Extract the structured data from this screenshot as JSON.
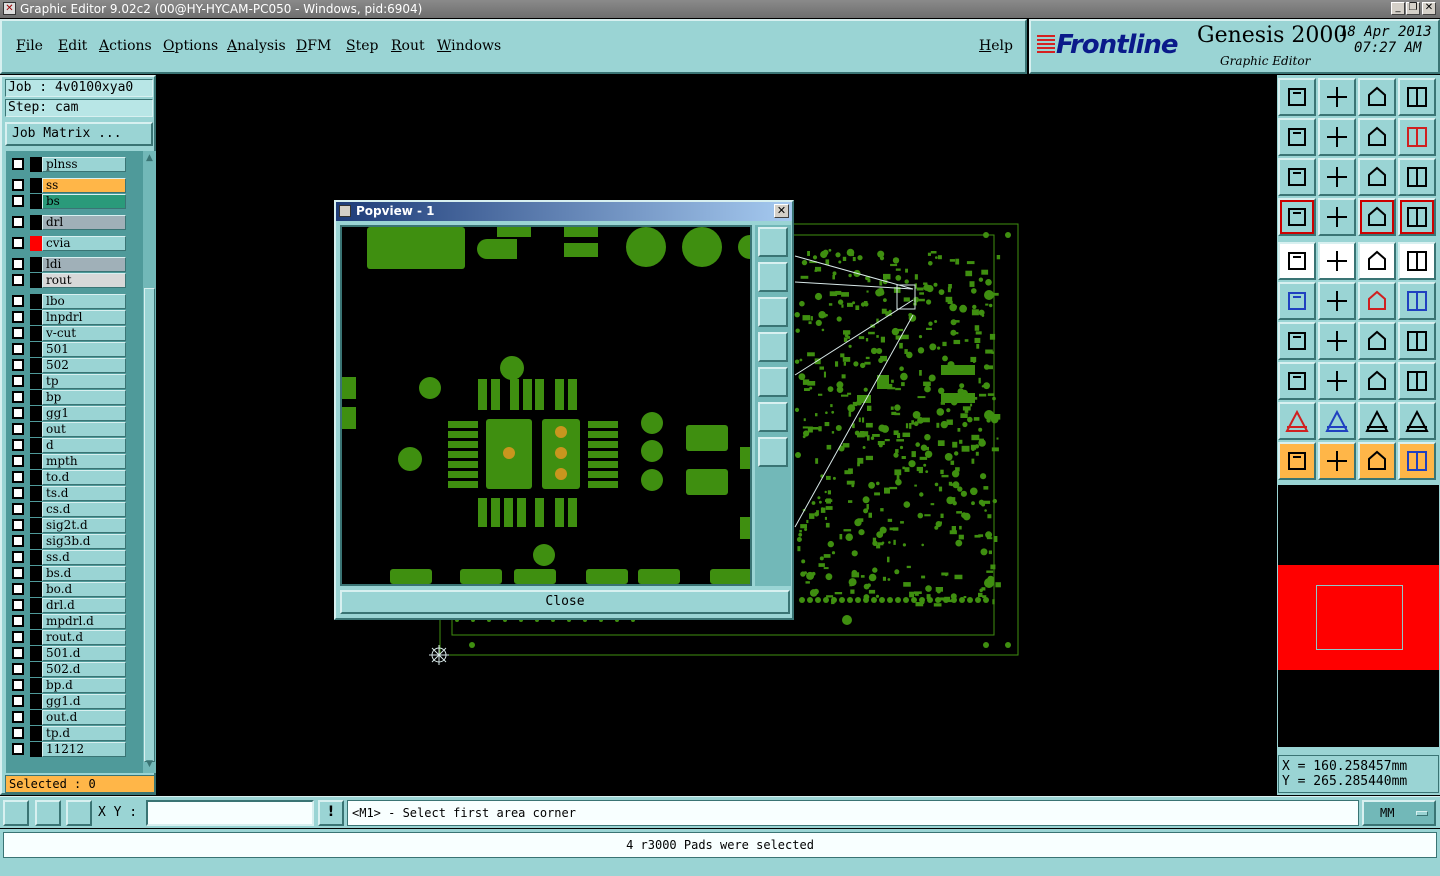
{
  "window": {
    "title": "Graphic Editor 9.02c2 (00@HY-HYCAM-PC050 - Windows, pid:6904)"
  },
  "menu": {
    "items": [
      "File",
      "Edit",
      "Actions",
      "Options",
      "Analysis",
      "DFM",
      "Step",
      "Rout",
      "Windows"
    ],
    "help": "Help"
  },
  "brand": {
    "logo": "Frontline",
    "product": "Genesis 2000",
    "subtitle": "Graphic Editor",
    "date": "18 Apr 2013",
    "time": "07:27 AM"
  },
  "job": {
    "job_line": "Job : 4v0100xya0",
    "step_line": "Step: cam",
    "matrix_button": "Job Matrix ..."
  },
  "layers": [
    {
      "name": "plnss",
      "color": ""
    },
    {
      "name": "ss",
      "color": "#ffb648"
    },
    {
      "name": "bs",
      "color": "#2a9a7a"
    },
    {
      "name": "drl",
      "color": "#a0b0b8"
    },
    {
      "name": "cvia",
      "color": "",
      "swatch": "#ff0000"
    },
    {
      "name": "ldi",
      "color": "#a0b0b8"
    },
    {
      "name": "rout",
      "color": "#d8d8d8"
    },
    {
      "name": "lbo",
      "color": ""
    },
    {
      "name": "lnpdrl",
      "color": ""
    },
    {
      "name": "v-cut",
      "color": ""
    },
    {
      "name": "501",
      "color": ""
    },
    {
      "name": "502",
      "color": ""
    },
    {
      "name": "tp",
      "color": ""
    },
    {
      "name": "bp",
      "color": ""
    },
    {
      "name": "gg1",
      "color": ""
    },
    {
      "name": "out",
      "color": ""
    },
    {
      "name": "d",
      "color": ""
    },
    {
      "name": "mpth",
      "color": ""
    },
    {
      "name": "to.d",
      "color": ""
    },
    {
      "name": "ts.d",
      "color": ""
    },
    {
      "name": "cs.d",
      "color": ""
    },
    {
      "name": "sig2t.d",
      "color": ""
    },
    {
      "name": "sig3b.d",
      "color": ""
    },
    {
      "name": "ss.d",
      "color": ""
    },
    {
      "name": "bs.d",
      "color": ""
    },
    {
      "name": "bo.d",
      "color": ""
    },
    {
      "name": "drl.d",
      "color": ""
    },
    {
      "name": "mpdrl.d",
      "color": ""
    },
    {
      "name": "rout.d",
      "color": ""
    },
    {
      "name": "501.d",
      "color": ""
    },
    {
      "name": "502.d",
      "color": ""
    },
    {
      "name": "bp.d",
      "color": ""
    },
    {
      "name": "gg1.d",
      "color": ""
    },
    {
      "name": "out.d",
      "color": ""
    },
    {
      "name": "tp.d",
      "color": ""
    },
    {
      "name": "11212",
      "color": ""
    }
  ],
  "selected": "Selected : 0",
  "popview": {
    "title": "Popview - 1",
    "close_label": "Close"
  },
  "coords": {
    "x": "X = 160.258457mm",
    "y": "Y = 265.285440mm"
  },
  "bottom": {
    "xy_label": "X Y :",
    "xy_value": "",
    "prompt": "<M1> - Select first area corner",
    "unit": "MM",
    "status": "4 r3000 Pads were selected"
  },
  "colors": {
    "panel": "#9ad4d4",
    "copper": "#3f8f10",
    "highlight": "#c8961e"
  }
}
